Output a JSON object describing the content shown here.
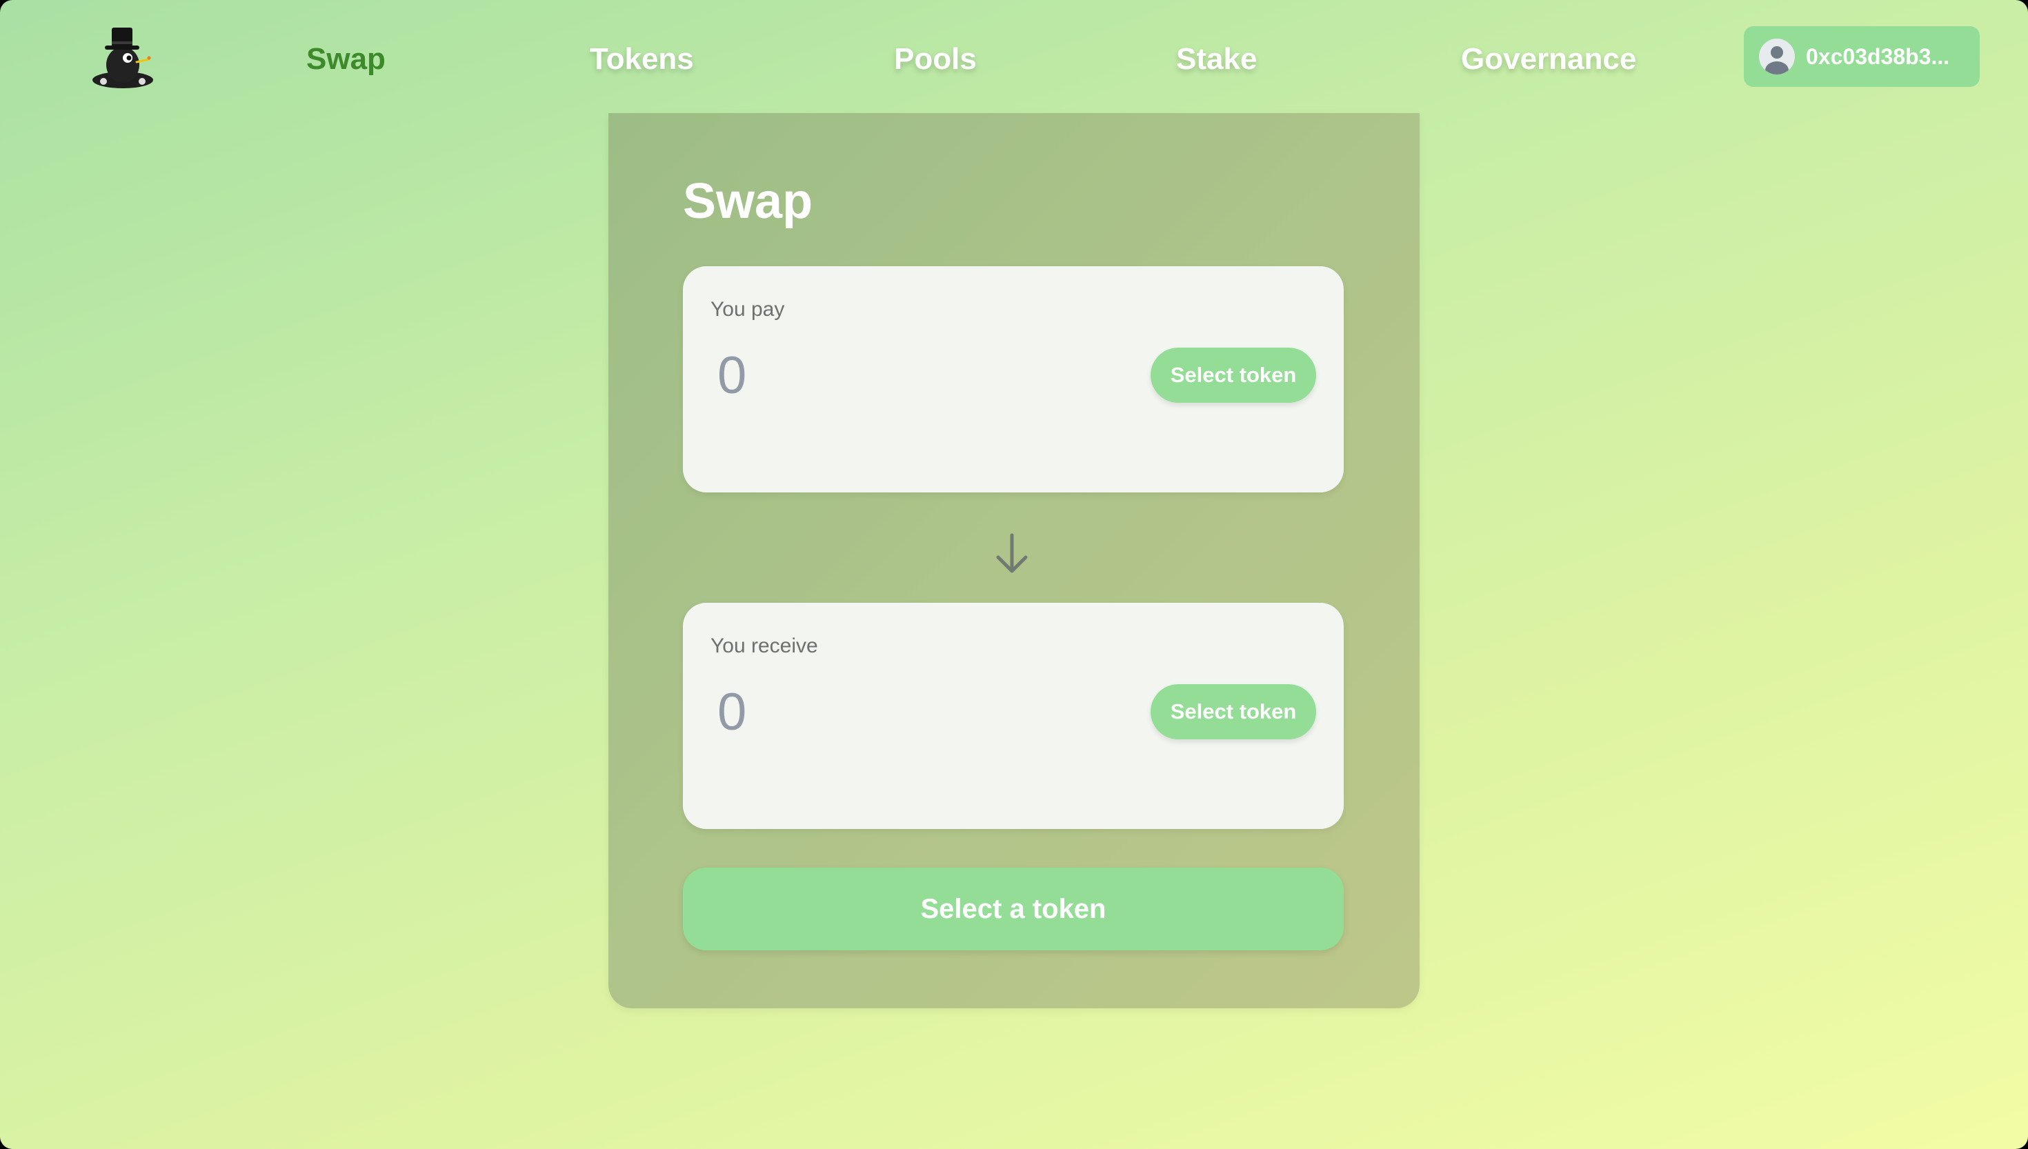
{
  "header": {
    "logo_icon": "top-hat-mole-logo-icon",
    "nav": {
      "swap": "Swap",
      "tokens": "Tokens",
      "pools": "Pools",
      "stake": "Stake",
      "governance": "Governance"
    },
    "active_nav": "swap",
    "wallet": {
      "avatar_icon": "user-avatar-icon",
      "address": "0xc03d38b3..."
    }
  },
  "swap": {
    "title": "Swap",
    "pay": {
      "label": "You pay",
      "placeholder": "0",
      "select_label": "Select token"
    },
    "direction_icon": "arrow-down-icon",
    "receive": {
      "label": "You receive",
      "placeholder": "0",
      "select_label": "Select token"
    },
    "submit_label": "Select a token"
  },
  "colors": {
    "accent": "#93dd96",
    "active_nav": "#3d8a2a",
    "card": "#aec48a",
    "panel": "#f3f6f0"
  }
}
